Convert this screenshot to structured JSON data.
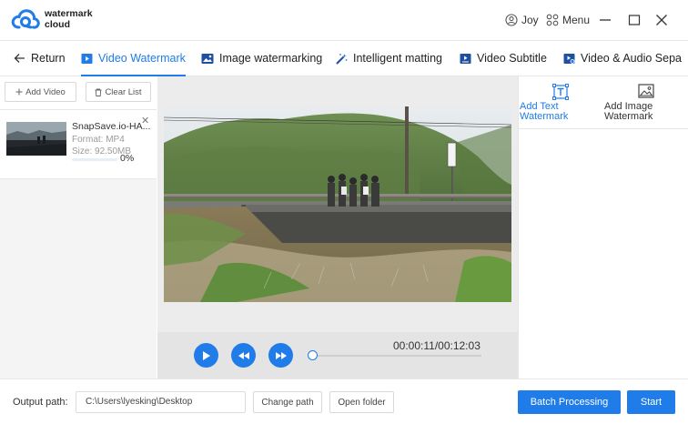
{
  "app": {
    "logo_line1": "watermark",
    "logo_line2": "cloud",
    "user_name": "Joy",
    "menu_label": "Menu"
  },
  "tabs": [
    {
      "label": "Return",
      "icon": "arrow-left-icon"
    },
    {
      "label": "Video Watermark",
      "icon": "video-watermark-icon",
      "active": true
    },
    {
      "label": "Image watermarking",
      "icon": "image-icon"
    },
    {
      "label": "Intelligent matting",
      "icon": "magic-wand-icon"
    },
    {
      "label": "Video Subtitle",
      "icon": "video-subtitle-icon"
    },
    {
      "label": "Video & Audio Sepa",
      "icon": "video-audio-icon"
    }
  ],
  "left_panel": {
    "add_video": "Add Video",
    "clear_list": "Clear List",
    "file": {
      "name": "SnapSave.io-HA...",
      "format": "Format:  MP4",
      "size": "Size:  92.50MB",
      "progress": "0%",
      "progress_value": 0
    }
  },
  "player": {
    "time": "00:00:11/00:12:03",
    "position_fraction": 0.015
  },
  "right_panel": {
    "text_watermark_line1": "Add Text",
    "text_watermark_line2": "Watermark",
    "image_watermark_line1": "Add Image",
    "image_watermark_line2": "Watermark"
  },
  "bottom": {
    "output_label": "Output path:",
    "output_path": "C:\\Users\\lyesking\\Desktop",
    "change_path": "Change path",
    "open_folder": "Open folder",
    "batch_processing": "Batch Processing",
    "start": "Start"
  },
  "colors": {
    "accent": "#1f7ce8",
    "panel_bg": "#ececec"
  }
}
